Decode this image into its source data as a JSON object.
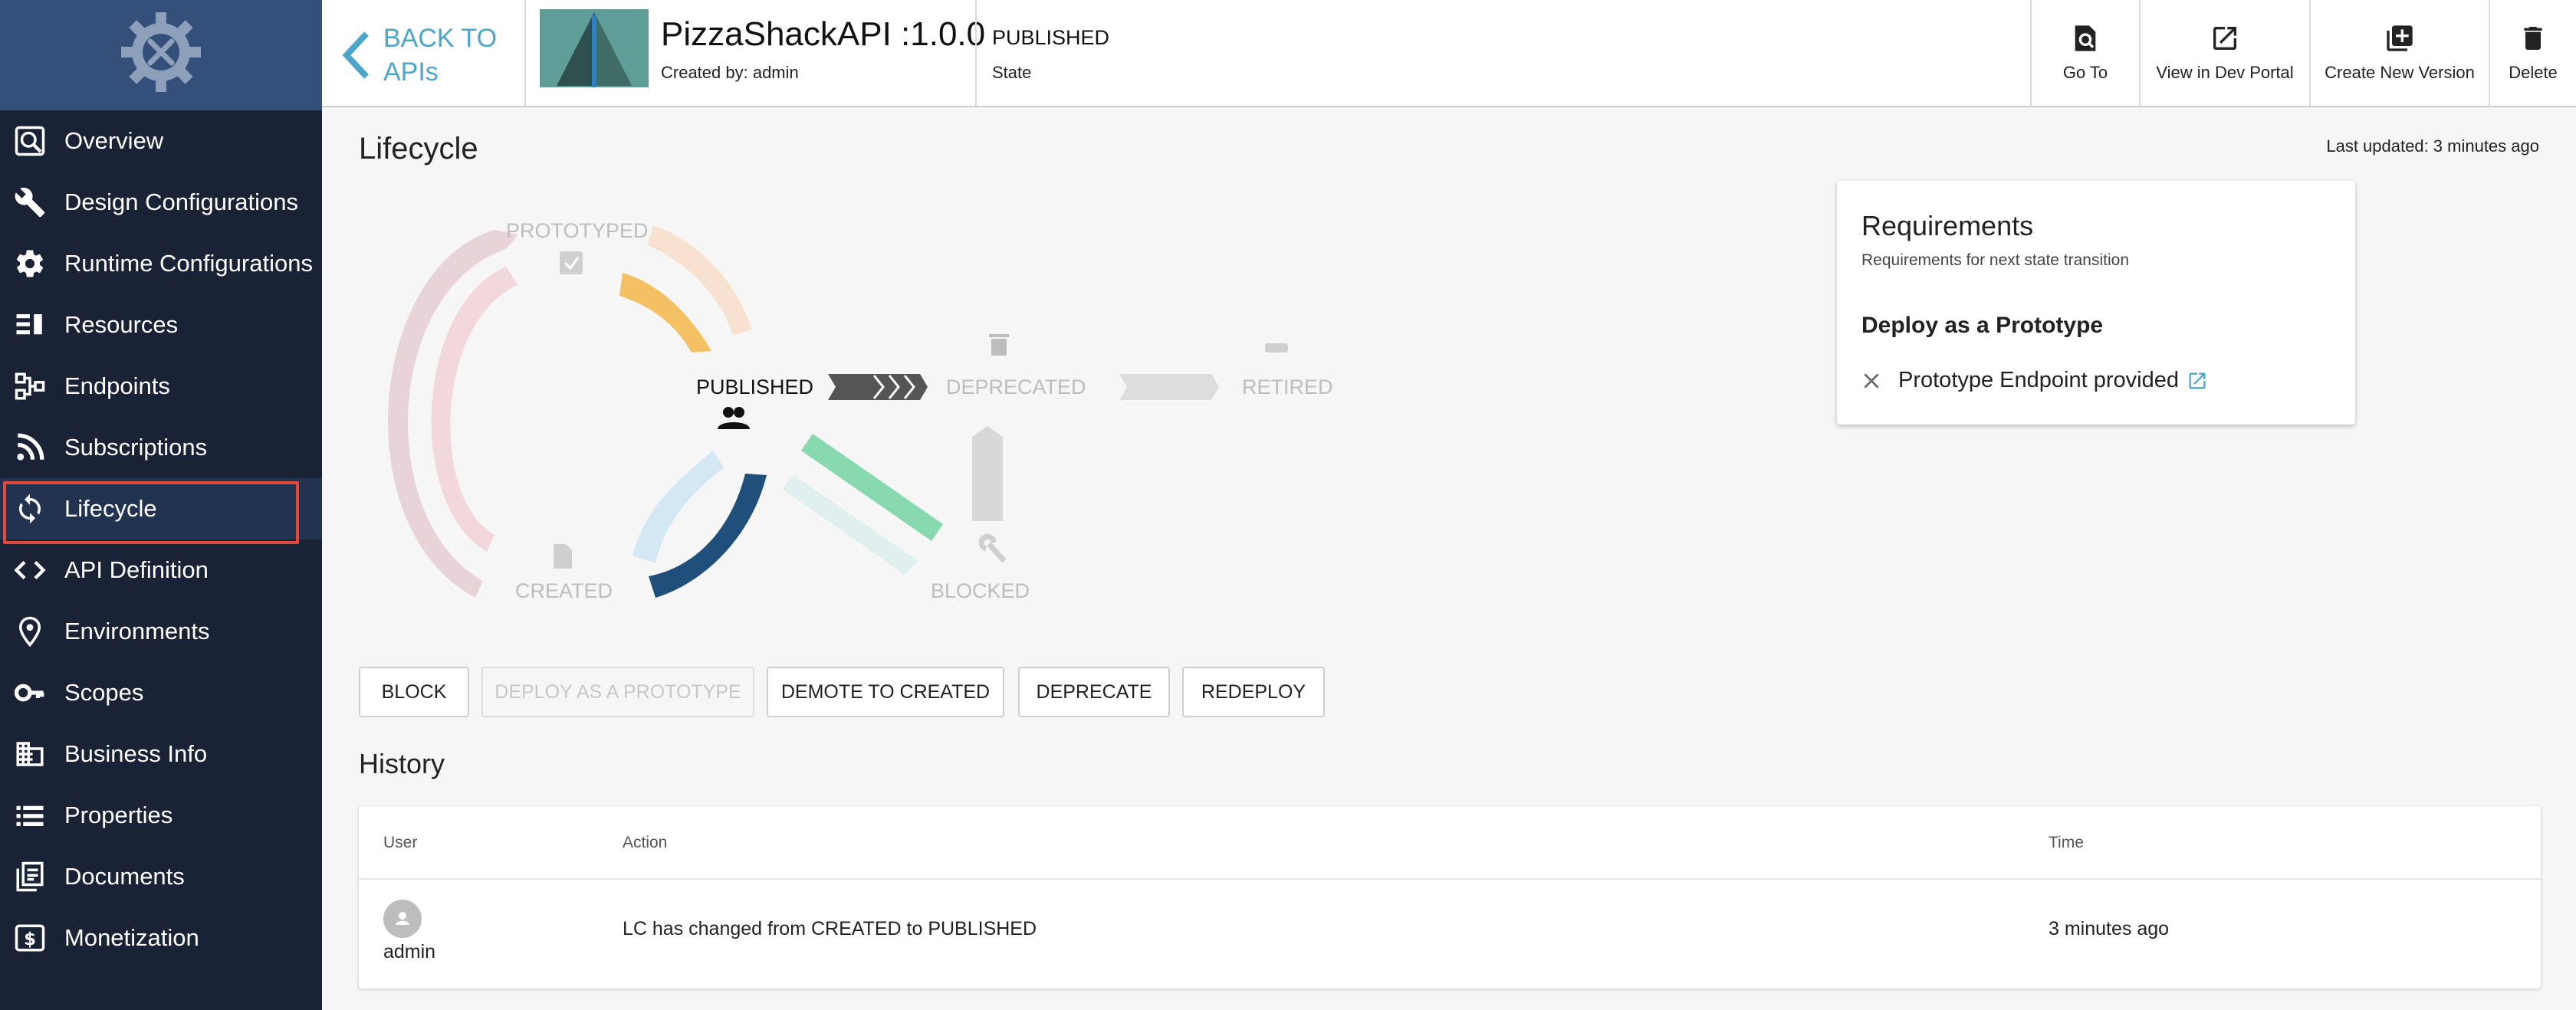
{
  "sidebar": {
    "items": [
      {
        "label": "Overview",
        "icon": "overview-icon"
      },
      {
        "label": "Design Configurations",
        "icon": "wrench-icon"
      },
      {
        "label": "Runtime Configurations",
        "icon": "gear-icon"
      },
      {
        "label": "Resources",
        "icon": "resources-icon"
      },
      {
        "label": "Endpoints",
        "icon": "endpoints-icon"
      },
      {
        "label": "Subscriptions",
        "icon": "rss-icon"
      },
      {
        "label": "Lifecycle",
        "icon": "lifecycle-icon"
      },
      {
        "label": "API Definition",
        "icon": "code-icon"
      },
      {
        "label": "Environments",
        "icon": "location-pin-icon"
      },
      {
        "label": "Scopes",
        "icon": "key-icon"
      },
      {
        "label": "Business Info",
        "icon": "building-icon"
      },
      {
        "label": "Properties",
        "icon": "list-icon"
      },
      {
        "label": "Documents",
        "icon": "documents-icon"
      },
      {
        "label": "Monetization",
        "icon": "monetization-icon"
      }
    ],
    "active": "Lifecycle"
  },
  "header": {
    "back_label": "BACK TO APIs",
    "api_name": "PizzaShackAPI :1.0.0",
    "created_by": "Created by: admin",
    "state_value": "PUBLISHED",
    "state_label": "State",
    "buttons": {
      "go_to": "Go To",
      "view_dev_portal": "View in Dev Portal",
      "create_new_version": "Create New Version",
      "delete": "Delete"
    }
  },
  "main": {
    "title": "Lifecycle",
    "last_updated": "Last updated: 3 minutes ago",
    "states": {
      "prototyped": "PROTOTYPED",
      "published": "PUBLISHED",
      "deprecated": "DEPRECATED",
      "retired": "RETIRED",
      "created": "CREATED",
      "blocked": "BLOCKED"
    },
    "current_state": "PUBLISHED"
  },
  "requirements": {
    "title": "Requirements",
    "subtitle": "Requirements for next state transition",
    "heading": "Deploy as a Prototype",
    "item": "Prototype Endpoint provided",
    "item_met": false
  },
  "actions": [
    {
      "label": "BLOCK",
      "enabled": true
    },
    {
      "label": "DEPLOY AS A PROTOTYPE",
      "enabled": false
    },
    {
      "label": "DEMOTE TO CREATED",
      "enabled": true
    },
    {
      "label": "DEPRECATE",
      "enabled": true
    },
    {
      "label": "REDEPLOY",
      "enabled": true
    }
  ],
  "history": {
    "title": "History",
    "columns": [
      "User",
      "Action",
      "Time"
    ],
    "rows": [
      {
        "user": "admin",
        "action": "LC has changed from CREATED to PUBLISHED",
        "time": "3 minutes ago"
      }
    ]
  },
  "colors": {
    "sidebar_bg": "#1a2336",
    "sidebar_logo_bg": "#34507a",
    "accent": "#4ca6c9",
    "highlight": "#e3483a"
  }
}
